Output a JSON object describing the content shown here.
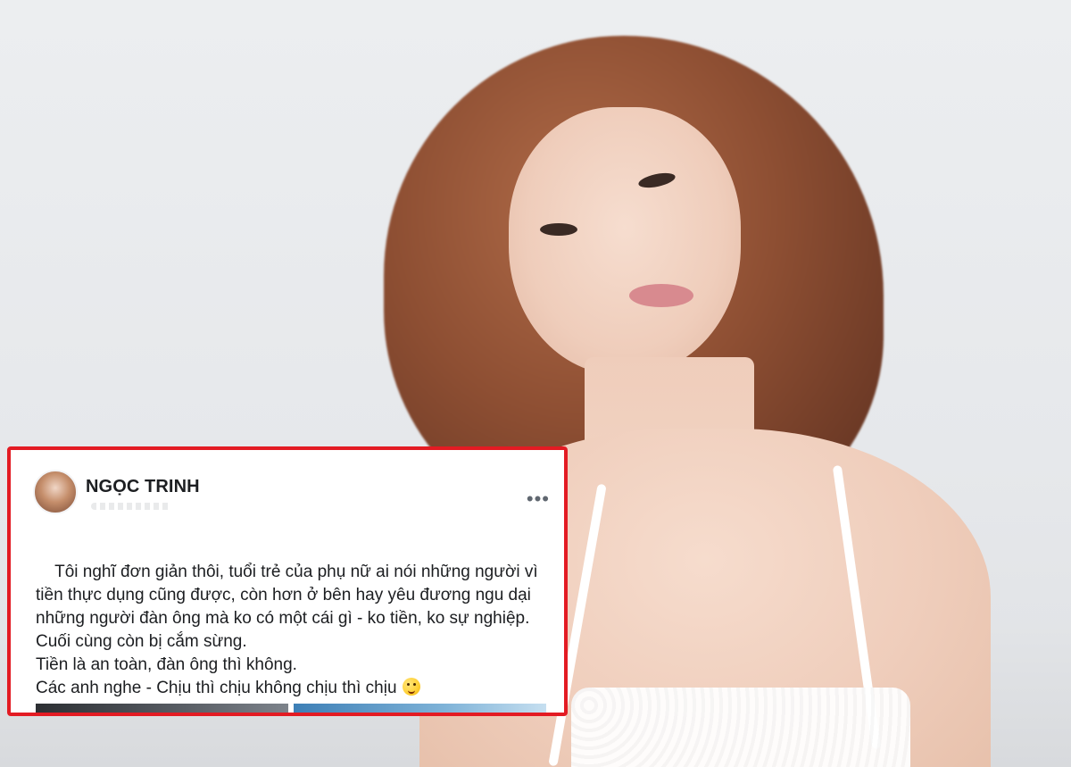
{
  "post": {
    "author_name": "NGỌC TRINH",
    "more_menu_label": "•••",
    "text": "Tôi nghĩ đơn giản thôi, tuổi trẻ của phụ nữ ai nói những người vì tiền thực dụng cũng được, còn hơn ở bên hay yêu đương ngu dại những người đàn ông mà ko có một cái gì - ko tiền, ko sự nghiệp. Cuối cùng còn bị cắm sừng.\nTiền là an toàn, đàn ông thì không.\nCác anh nghe - Chịu thì chịu không chịu thì chịu"
  },
  "colors": {
    "highlight_border": "#e31b23",
    "card_background": "#ffffff",
    "text_primary": "#1c1e21",
    "icon_gray": "#606770"
  },
  "icons": {
    "more": "more-horizontal-icon",
    "emoji": "laughing-emoji-icon"
  }
}
